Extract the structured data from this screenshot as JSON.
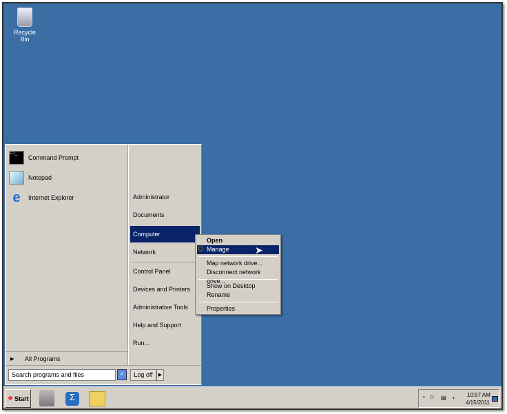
{
  "desktop": {
    "recycle_bin": "Recycle Bin"
  },
  "start_menu": {
    "pinned": [
      {
        "label": "Command Prompt",
        "icon": "cmd-icon"
      },
      {
        "label": "Notepad",
        "icon": "notepad-icon"
      },
      {
        "label": "Internet Explorer",
        "icon": "ie-icon"
      }
    ],
    "right_items": [
      "Administrator",
      "Documents",
      "Computer",
      "Network",
      "Control Panel",
      "Devices and Printers",
      "Administrative Tools",
      "Help and Support",
      "Run..."
    ],
    "all_programs": "All Programs",
    "search_placeholder": "Search programs and files",
    "log_off": "Log off"
  },
  "context_menu": {
    "items": [
      "Open",
      "Manage",
      "Map network drive...",
      "Disconnect network drive...",
      "Show on Desktop",
      "Rename",
      "Properties"
    ]
  },
  "taskbar": {
    "start": "Start",
    "time": "10:57 AM",
    "date": "4/15/2011"
  },
  "colors": {
    "desktop": "#3a6ea5",
    "highlight": "#0a246a",
    "menu": "#d4d0c8"
  }
}
